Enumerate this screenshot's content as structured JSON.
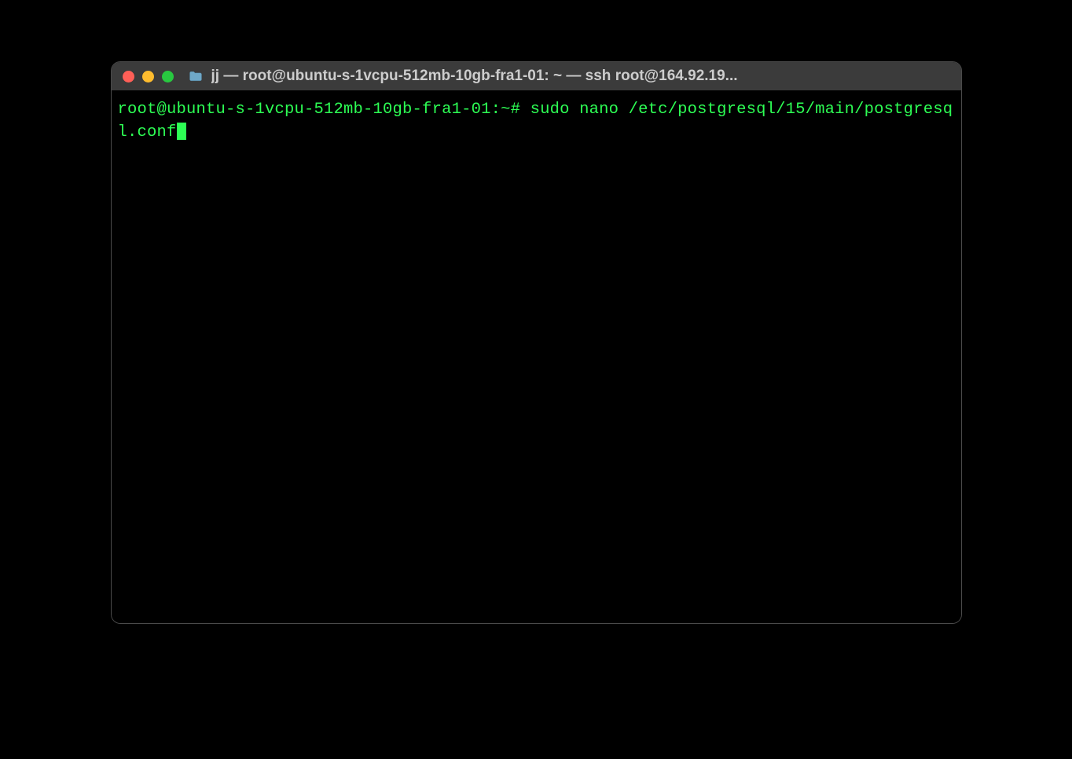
{
  "window": {
    "title": "jj — root@ubuntu-s-1vcpu-512mb-10gb-fra1-01: ~ — ssh root@164.92.19..."
  },
  "terminal": {
    "prompt": "root@ubuntu-s-1vcpu-512mb-10gb-fra1-01:~#",
    "command": "sudo nano /etc/postgresql/15/main/postgresql.conf"
  },
  "colors": {
    "terminal_text": "#2dfe54",
    "close_button": "#ff5f57",
    "minimize_button": "#febc2e",
    "maximize_button": "#28c840"
  }
}
